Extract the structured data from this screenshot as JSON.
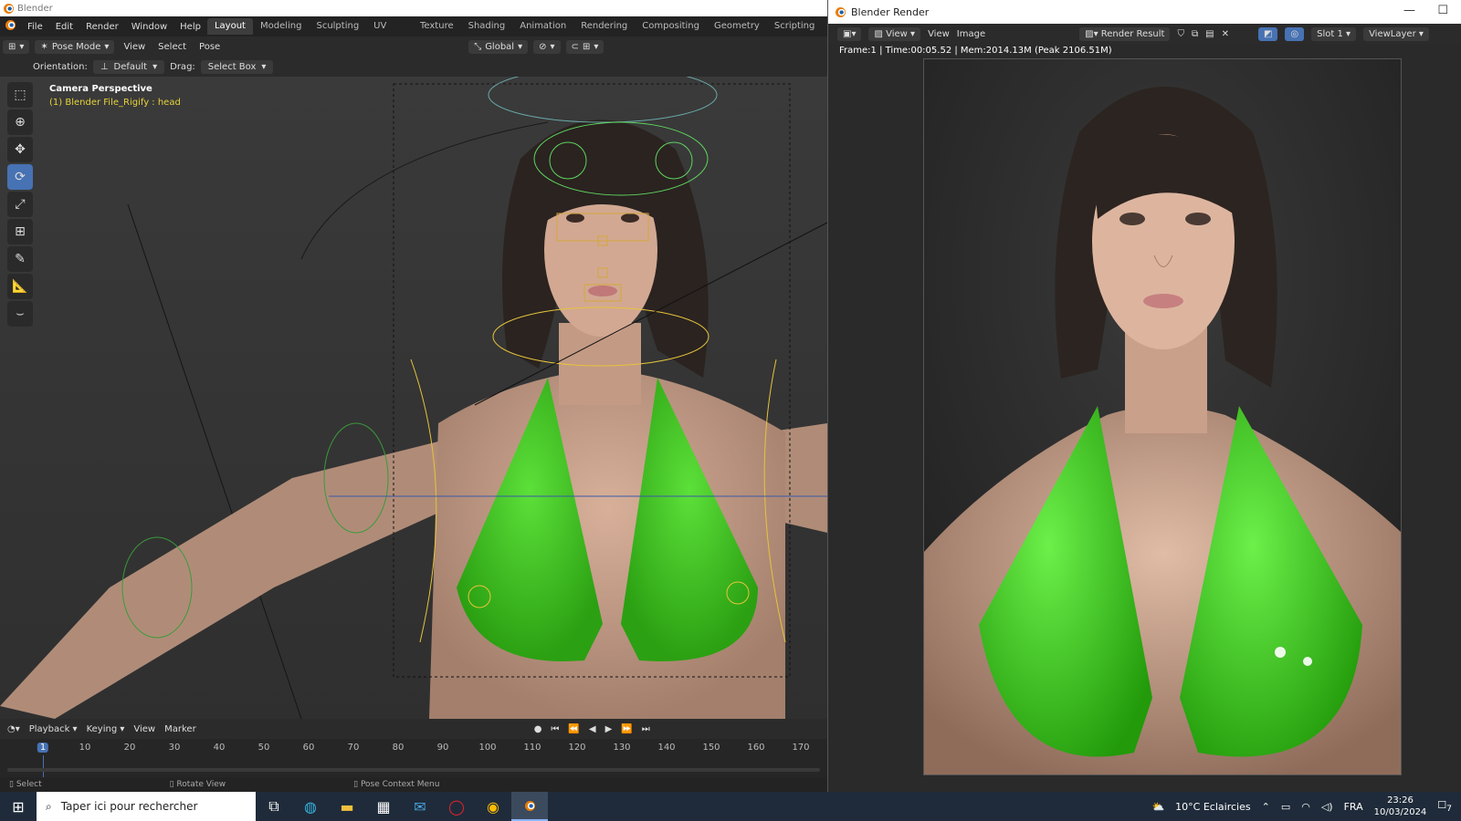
{
  "main_window": {
    "title": "Blender",
    "menus": [
      "File",
      "Edit",
      "Render",
      "Window",
      "Help"
    ],
    "workspaces": [
      "Layout",
      "Modeling",
      "Sculpting",
      "UV Editing",
      "Texture Paint",
      "Shading",
      "Animation",
      "Rendering",
      "Compositing",
      "Geometry Nodes",
      "Scripting"
    ],
    "active_workspace": "Layout",
    "add_workspace": "+",
    "header": {
      "mode": "Pose Mode",
      "view": "View",
      "select": "Select",
      "pose": "Pose",
      "transform": "Global"
    },
    "orientation_label": "Orientation:",
    "orientation_value": "Default",
    "drag_label": "Drag:",
    "drag_value": "Select Box",
    "viewport": {
      "camera_label": "Camera Perspective",
      "object_label": "(1) Blender File_Rigify : head"
    },
    "timeline": {
      "playback": "Playback",
      "keying": "Keying",
      "view": "View",
      "marker": "Marker",
      "current_frame": "1",
      "ticks": [
        "10",
        "20",
        "30",
        "40",
        "50",
        "60",
        "70",
        "80",
        "90",
        "100",
        "110",
        "120",
        "130",
        "140",
        "150",
        "160",
        "170"
      ]
    },
    "status": {
      "select": "Select",
      "rotate": "Rotate View",
      "context": "Pose Context Menu"
    }
  },
  "render_window": {
    "title": "Blender Render",
    "view": "View",
    "view2": "View",
    "image": "Image",
    "result": "Render Result",
    "slot": "Slot 1",
    "layer": "ViewLayer",
    "frame_info": "Frame:1 | Time:00:05.52 | Mem:2014.13M (Peak 2106.51M)"
  },
  "taskbar": {
    "search_placeholder": "Taper ici pour rechercher",
    "weather": "10°C  Eclaircies",
    "lang": "FRA",
    "time": "23:26",
    "date": "10/03/2024",
    "notif_count": "7"
  },
  "colors": {
    "accent": "#4772b3",
    "bikini": "#3ec31a",
    "skin": "#c9a088",
    "rig_yellow": "#e6c43b"
  }
}
